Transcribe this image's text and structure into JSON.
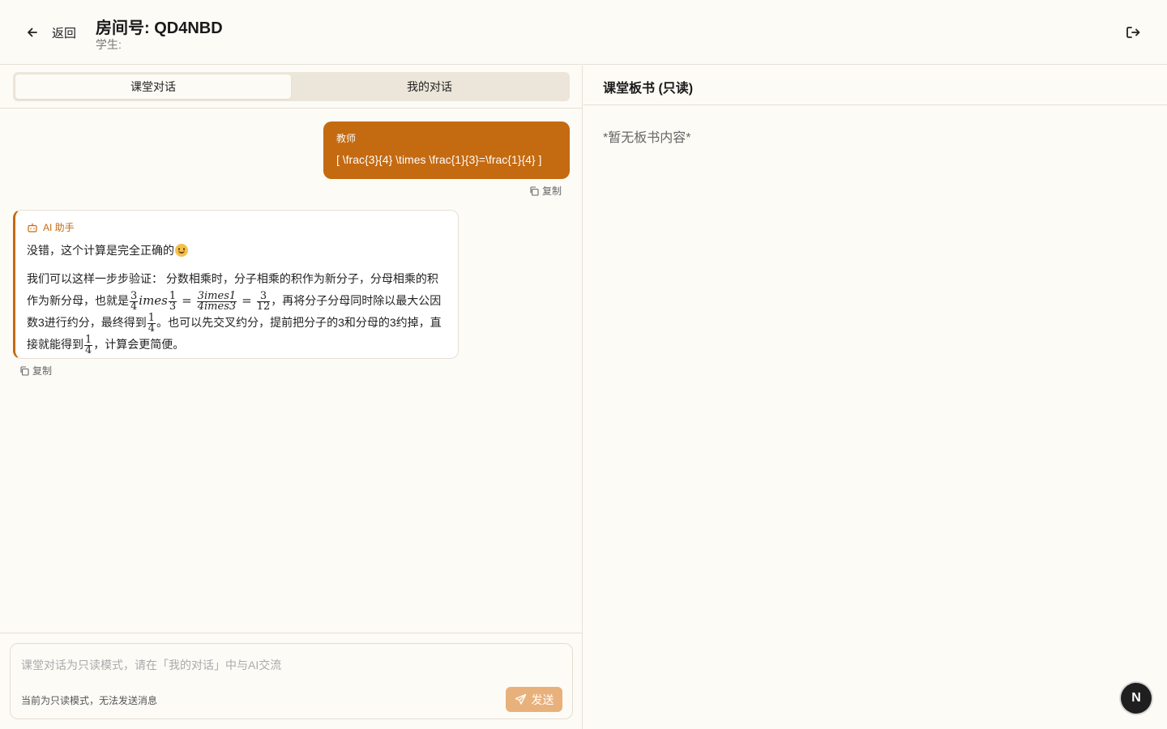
{
  "header": {
    "back_label": "返回",
    "room_title": "房间号: QD4NBD",
    "student_label": "学生:"
  },
  "tabs": {
    "class_chat": "课堂对话",
    "my_chat": "我的对话"
  },
  "messages": {
    "teacher": {
      "sender": "教师",
      "text": "[ \\frac{3}{4} \\times \\frac{1}{3}=\\frac{1}{4} ]",
      "copy_label": "复制"
    },
    "ai": {
      "sender": "AI 助手",
      "line1": "没错，这个计算是完全正确的",
      "para_part1": "我们可以这样一步步验证： 分数相乘时，分子相乘的积作为新分子，分母相乘的积作为新分母，也就是",
      "math_imes1": "imes",
      "math_num1": "3imes1",
      "math_den1": "4imes3",
      "para_part2": "，再将分子分母同时除以最大公因数3进行约分，最终得到",
      "para_part3": "。也可以先交叉约分，提前把分子的3和分母的3约掉，直接就能得到",
      "para_part4": "，计算会更简便。",
      "copy_label": "复制"
    }
  },
  "input": {
    "placeholder": "课堂对话为只读模式，请在「我的对话」中与AI交流",
    "readonly_note": "当前为只读模式，无法发送消息",
    "send_label": "发送"
  },
  "board": {
    "title": "课堂板书 (只读)",
    "empty_text": "*暂无板书内容*"
  },
  "fab_label": "N",
  "colors": {
    "accent": "#c46a11",
    "background": "#fdfbf6",
    "send_disabled": "#e8b17c"
  }
}
